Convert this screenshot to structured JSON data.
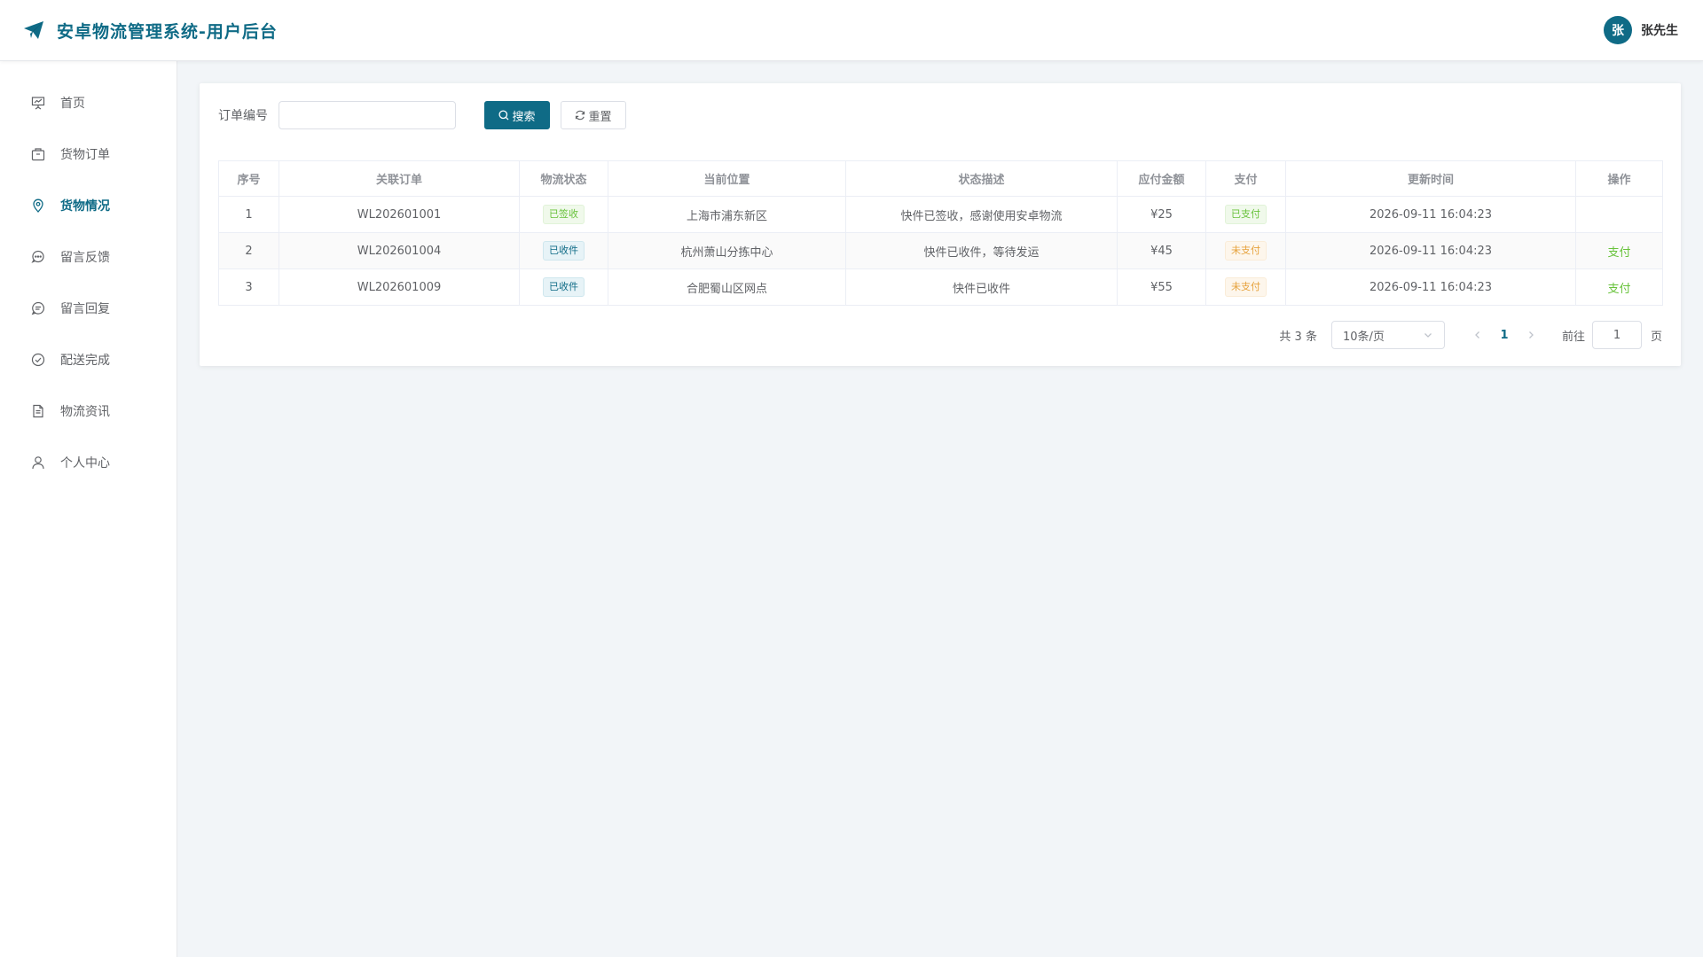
{
  "header": {
    "title": "安卓物流管理系统-用户后台",
    "avatar_text": "张",
    "user_name": "张先生",
    "brand_color": "#0f6b86"
  },
  "sidebar": {
    "items": [
      {
        "label": "首页",
        "icon": "presentation-icon",
        "active": false
      },
      {
        "label": "货物订单",
        "icon": "package-icon",
        "active": false
      },
      {
        "label": "货物情况",
        "icon": "location-pin-icon",
        "active": true
      },
      {
        "label": "留言反馈",
        "icon": "chat-bubble-icon",
        "active": false
      },
      {
        "label": "留言回复",
        "icon": "chat-reply-icon",
        "active": false
      },
      {
        "label": "配送完成",
        "icon": "check-circle-icon",
        "active": false
      },
      {
        "label": "物流资讯",
        "icon": "document-icon",
        "active": false
      },
      {
        "label": "个人中心",
        "icon": "user-icon",
        "active": false
      }
    ]
  },
  "search": {
    "label": "订单编号",
    "value": "",
    "placeholder": "",
    "search_button": "搜索",
    "reset_button": "重置"
  },
  "table": {
    "columns": [
      "序号",
      "关联订单",
      "物流状态",
      "当前位置",
      "状态描述",
      "应付金额",
      "支付",
      "更新时间",
      "操作"
    ],
    "rows": [
      {
        "index": "1",
        "order": "WL202601001",
        "status": "已签收",
        "location": "上海市浦东新区",
        "desc": "快件已签收，感谢使用安卓物流",
        "amount": "¥25",
        "pay": "已支付",
        "time": "2026-09-11 16:04:23",
        "op": ""
      },
      {
        "index": "2",
        "order": "WL202601004",
        "status": "已收件",
        "location": "杭州萧山分拣中心",
        "desc": "快件已收件，等待发运",
        "amount": "¥45",
        "pay": "未支付",
        "time": "2026-09-11 16:04:23",
        "op": "支付"
      },
      {
        "index": "3",
        "order": "WL202601009",
        "status": "已收件",
        "location": "合肥蜀山区网点",
        "desc": "快件已收件",
        "amount": "¥55",
        "pay": "未支付",
        "time": "2026-09-11 16:04:23",
        "op": "支付"
      }
    ]
  },
  "pagination": {
    "total": "共 3 条",
    "page_size": "10条/页",
    "current_page": "1",
    "jump_label": "前往",
    "jump_value": "1",
    "page_suffix": "页"
  }
}
